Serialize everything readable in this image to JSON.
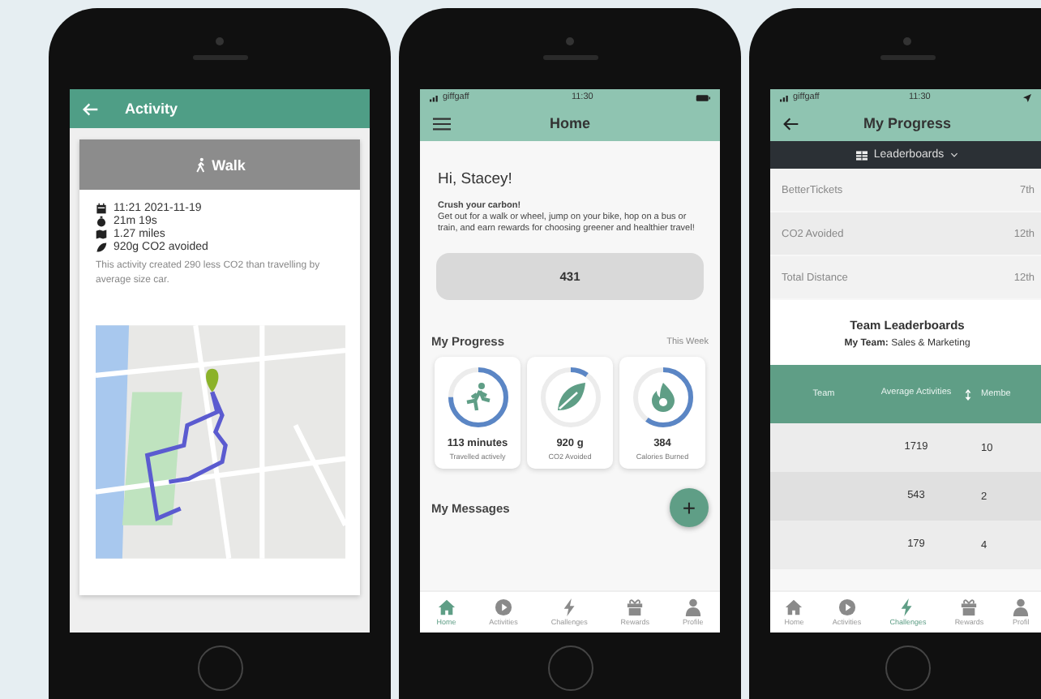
{
  "activity_screen": {
    "title": "Activity",
    "activity_type": "Walk",
    "details": [
      {
        "kind": "calendar",
        "text": "11:21 2021-11-19"
      },
      {
        "kind": "timer",
        "text": "21m 19s"
      },
      {
        "kind": "map",
        "text": "1.27 miles"
      },
      {
        "kind": "leaf",
        "text": "920g CO2 avoided"
      }
    ],
    "summary": "This activity created 290 less CO2 than travelling by average size car."
  },
  "home_screen": {
    "status_bar": {
      "carrier": "giffgaff",
      "time": "11:30"
    },
    "title": "Home",
    "greeting": "Hi, Stacey!",
    "intro": "**Crush your carbon!**\nGet out for a walk or wheel, jump on your bike, hop on a bus or train, and earn rewards for choosing greener and healthier travel!",
    "score": "431",
    "progress": {
      "title": "My Progress",
      "period": "This Week",
      "cards": [
        {
          "kind": "runner",
          "value": "113 minutes",
          "label": "Travelled actively",
          "level": 0.75
        },
        {
          "kind": "leaf",
          "value": "920 g",
          "label": "CO2 Avoided",
          "level": 0.1
        },
        {
          "kind": "flame",
          "value": "384",
          "label": "Calories Burned",
          "level": 0.6
        }
      ]
    },
    "messages_title": "My Messages",
    "fab": "+",
    "nav": [
      {
        "kind": "home",
        "label": "Home",
        "selected": true
      },
      {
        "kind": "play",
        "label": "Activities",
        "selected": false
      },
      {
        "kind": "bolt",
        "label": "Challenges",
        "selected": false
      },
      {
        "kind": "gift",
        "label": "Rewards",
        "selected": false
      },
      {
        "kind": "person",
        "label": "Profile",
        "selected": false
      }
    ]
  },
  "progress_screen": {
    "status_bar": {
      "carrier": "giffgaff",
      "time": "11:30"
    },
    "title": "My Progress",
    "menu": "Leaderboards",
    "ranks": [
      {
        "label": "BetterTickets",
        "rank": "7th"
      },
      {
        "label": "CO2 Avoided",
        "rank": "12th"
      },
      {
        "label": "Total Distance",
        "rank": "12th"
      }
    ],
    "team_title": "Team Leaderboards",
    "team_line": "**My Team:** Sales & Marketing",
    "table": {
      "columns": [
        "Team",
        "Average Activities",
        "Membe"
      ],
      "rows": [
        {
          "average": "1719",
          "members": "10"
        },
        {
          "average": "543",
          "members": "2"
        },
        {
          "average": "179",
          "members": "4"
        }
      ]
    },
    "nav": [
      {
        "kind": "home",
        "label": "Home",
        "selected": false
      },
      {
        "kind": "play",
        "label": "Activities",
        "selected": false
      },
      {
        "kind": "bolt",
        "label": "Challenges",
        "selected": true
      },
      {
        "kind": "gift",
        "label": "Rewards",
        "selected": false
      },
      {
        "kind": "person",
        "label": "Profil",
        "selected": false
      }
    ]
  }
}
